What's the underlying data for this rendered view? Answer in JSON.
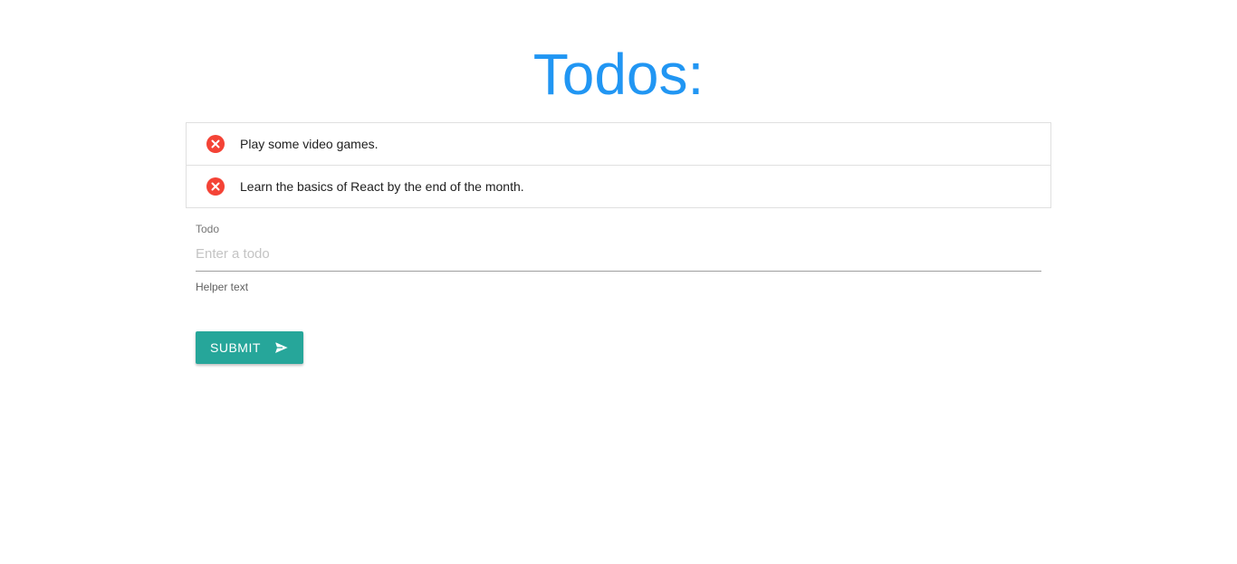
{
  "page": {
    "title": "Todos:"
  },
  "todos": [
    {
      "text": "Play some video games.",
      "delete_icon": "close-circle-icon"
    },
    {
      "text": "Learn the basics of React by the end of the month.",
      "delete_icon": "close-circle-icon"
    }
  ],
  "form": {
    "label": "Todo",
    "placeholder": "Enter a todo",
    "value": "",
    "helper_text": "Helper text",
    "submit_label": "SUBMIT",
    "submit_icon": "send-icon"
  },
  "colors": {
    "title": "#2196f3",
    "delete": "#f44336",
    "submit": "#26a69a"
  }
}
